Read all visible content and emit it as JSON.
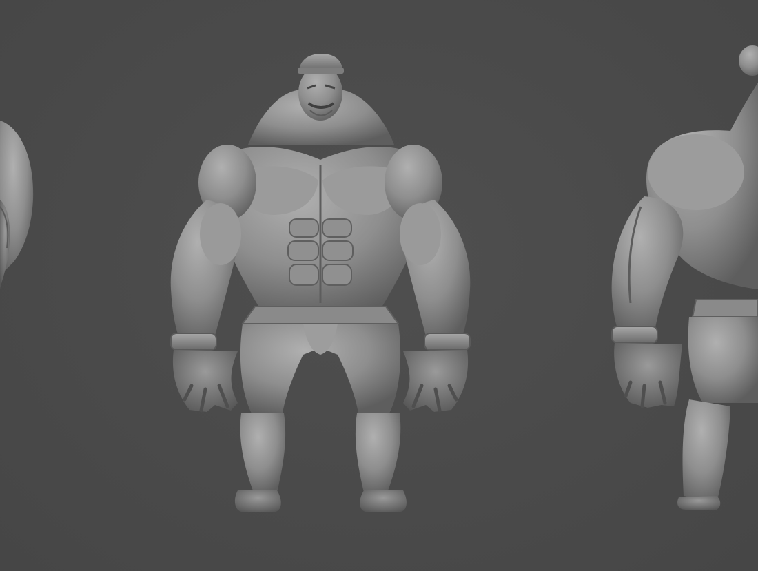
{
  "scene": {
    "background": "#4a4a4a",
    "model_color": "#8e8e8e",
    "model_shadow": "#5a5a5a",
    "model_highlight": "#b4b4b4"
  }
}
